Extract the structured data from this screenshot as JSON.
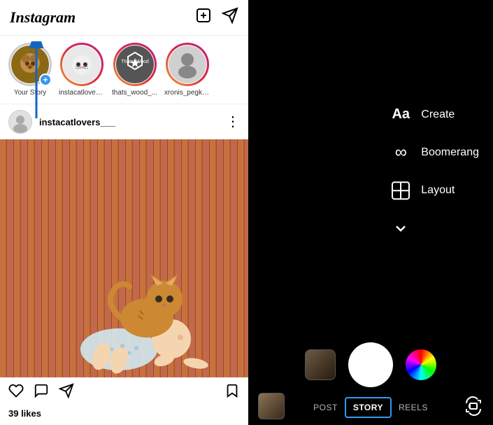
{
  "app": {
    "name": "Instagram"
  },
  "header": {
    "logo": "Instagram",
    "add_icon": "⊕",
    "send_icon": "✈"
  },
  "stories": [
    {
      "id": "your_story",
      "label": "Your Story",
      "has_ring": false,
      "is_yours": true,
      "avatar_color": "#8B6914"
    },
    {
      "id": "instacatlovers",
      "label": "instacatlovers...",
      "has_ring": true,
      "avatar_color": "#e0e0e0"
    },
    {
      "id": "thats_wood",
      "label": "thats_wood_...",
      "has_ring": true,
      "avatar_color": "#5a5a5a"
    },
    {
      "id": "xronis_pegk",
      "label": "xronis_pegk_...",
      "has_ring": true,
      "avatar_color": "#c0c0c0"
    }
  ],
  "post": {
    "username": "instacatlovers___",
    "more_label": "⋮",
    "likes_label": "39 likes"
  },
  "post_actions": {
    "like_icon": "♡",
    "comment_icon": "💬",
    "share_icon": "✈",
    "bookmark_icon": "🔖"
  },
  "right_panel": {
    "options": [
      {
        "id": "create",
        "icon": "Aa",
        "label": "Create"
      },
      {
        "id": "boomerang",
        "icon": "∞",
        "label": "Boomerang"
      },
      {
        "id": "layout",
        "icon": "▦",
        "label": "Layout"
      }
    ],
    "chevron": "∨",
    "modes": [
      {
        "id": "post",
        "label": "POST",
        "active": false
      },
      {
        "id": "story",
        "label": "STORY",
        "active": true
      },
      {
        "id": "reels",
        "label": "REELS",
        "active": false
      }
    ]
  }
}
